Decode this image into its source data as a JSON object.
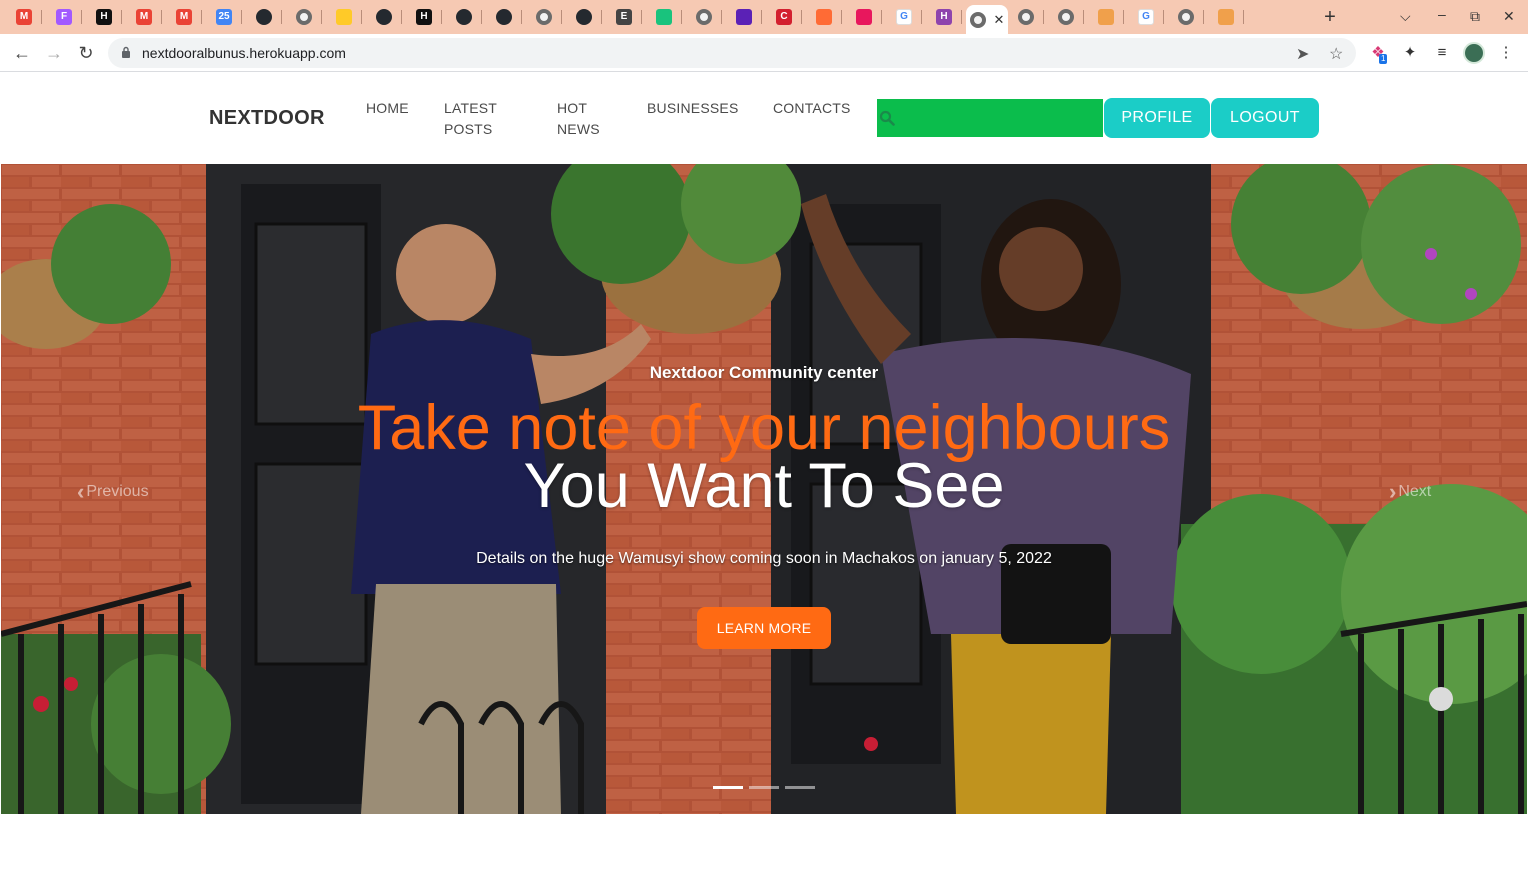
{
  "browser": {
    "tabs": [
      {
        "icon": "gmail-icon",
        "color": "#ea4335",
        "glyph": "M"
      },
      {
        "icon": "figma-icon",
        "color": "#a259ff",
        "glyph": "F"
      },
      {
        "icon": "hashnode-icon",
        "color": "#111111",
        "glyph": "H"
      },
      {
        "icon": "gmail-icon",
        "color": "#ea4335",
        "glyph": "M"
      },
      {
        "icon": "gmail-icon",
        "color": "#ea4335",
        "glyph": "M"
      },
      {
        "icon": "calendar-icon",
        "color": "#4285f4",
        "glyph": "25"
      },
      {
        "icon": "github-icon",
        "color": "#24292f",
        "glyph": ""
      },
      {
        "icon": "globe-icon",
        "color": "#6b6b6b",
        "glyph": ""
      },
      {
        "icon": "firebase-icon",
        "color": "#ffca28",
        "glyph": ""
      },
      {
        "icon": "github-icon",
        "color": "#24292f",
        "glyph": ""
      },
      {
        "icon": "hashnode-icon",
        "color": "#111111",
        "glyph": "H"
      },
      {
        "icon": "github-icon",
        "color": "#24292f",
        "glyph": ""
      },
      {
        "icon": "github-icon",
        "color": "#24292f",
        "glyph": ""
      },
      {
        "icon": "globe-icon",
        "color": "#6b6b6b",
        "glyph": ""
      },
      {
        "icon": "github-icon",
        "color": "#24292f",
        "glyph": ""
      },
      {
        "icon": "audio-tab-icon",
        "color": "#444444",
        "glyph": "E"
      },
      {
        "icon": "app-icon",
        "color": "#19c37d",
        "glyph": ""
      },
      {
        "icon": "globe-icon",
        "color": "#6b6b6b",
        "glyph": ""
      },
      {
        "icon": "app-icon",
        "color": "#5b21b6",
        "glyph": ""
      },
      {
        "icon": "app-icon",
        "color": "#d3202f",
        "glyph": "C"
      },
      {
        "icon": "app-icon",
        "color": "#ff6b35",
        "glyph": ""
      },
      {
        "icon": "app-icon",
        "color": "#e8175d",
        "glyph": ""
      },
      {
        "icon": "google-icon",
        "color": "#4285f4",
        "glyph": "G"
      },
      {
        "icon": "app-icon",
        "color": "#8e44ad",
        "glyph": "H"
      },
      {
        "icon": "globe-icon",
        "color": "#6b6b6b",
        "glyph": ""
      },
      {
        "icon": "globe-icon",
        "color": "#6b6b6b",
        "glyph": ""
      },
      {
        "icon": "globe-icon",
        "color": "#6b6b6b",
        "glyph": ""
      },
      {
        "icon": "app-icon",
        "color": "#f0a04b",
        "glyph": ""
      },
      {
        "icon": "google-icon",
        "color": "#4285f4",
        "glyph": "G"
      },
      {
        "icon": "globe-icon",
        "color": "#6b6b6b",
        "glyph": ""
      },
      {
        "icon": "app-icon",
        "color": "#f0a04b",
        "glyph": ""
      }
    ],
    "active_tab_index": 24,
    "url": "nextdooralbunus.herokuapp.com",
    "extension_badge": "1"
  },
  "site": {
    "brand": "NEXTDOOR",
    "nav": {
      "home": "HOME",
      "latest_posts": "LATEST POSTS",
      "hot_news": "HOT NEWS",
      "businesses": "BUSINESSES",
      "contacts": "CONTACTS"
    },
    "search": {
      "value": "",
      "placeholder": ""
    },
    "profile_label": "PROFILE",
    "logout_label": "LOGOUT",
    "colors": {
      "accent": "#ff6a13",
      "teal": "#1bcdc7",
      "search_green": "#0bbd4c"
    }
  },
  "hero": {
    "eyebrow": "Nextdoor Community center",
    "headline_1": "Take note of your neighbours",
    "headline_2": "You Want To See",
    "details": "Details on the huge Wamusyi show coming soon in Machakos on january 5, 2022",
    "cta_label": "LEARN MORE",
    "prev_label": "Previous",
    "next_label": "Next",
    "slides": 3,
    "active_slide": 1
  }
}
